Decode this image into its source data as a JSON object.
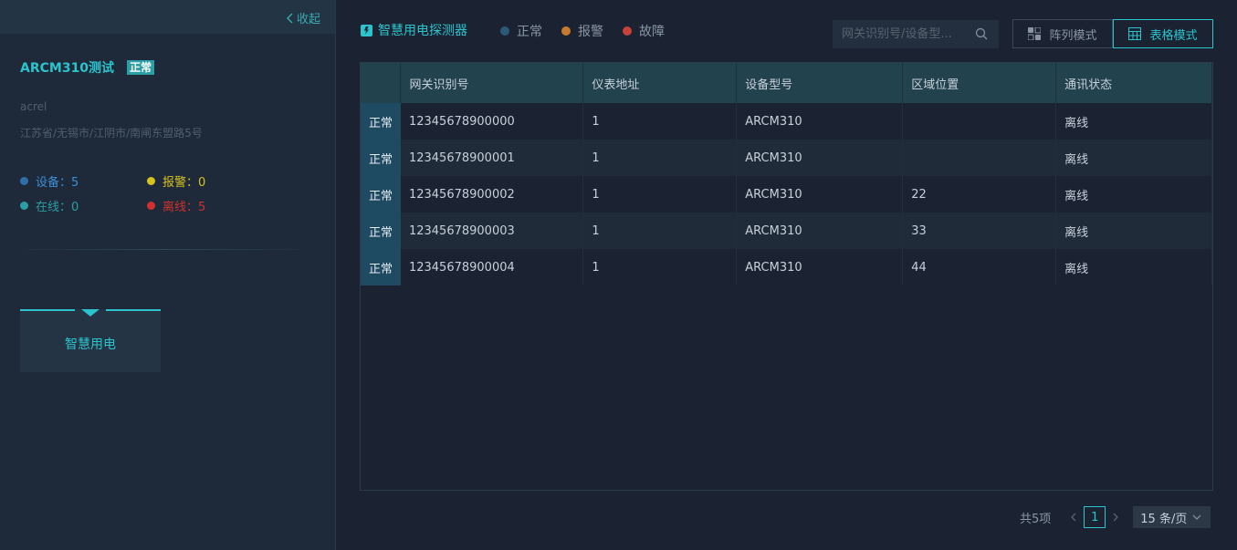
{
  "sidebar": {
    "collapse_label": "收起",
    "device_name": "ARCM310测试",
    "device_status": "正常",
    "company": "acrel",
    "address": "江苏省/无锡市/江阴市/南闸东盟路5号",
    "stats": {
      "devices": "设备：5",
      "alarm": "报警：0",
      "online": "在线：0",
      "offline": "离线：5"
    },
    "module_label": "智慧用电"
  },
  "header": {
    "title": "智慧用电探测器",
    "legend": [
      "正常",
      "报警",
      "故障"
    ],
    "search_placeholder": "网关识别号/设备型...",
    "list_mode": "阵列模式",
    "table_mode": "表格模式"
  },
  "table": {
    "columns": [
      "网关识别号",
      "仪表地址",
      "设备型号",
      "区域位置",
      "通讯状态"
    ],
    "rows": [
      {
        "status": "正常",
        "gateway": "12345678900000",
        "address": "1",
        "model": "ARCM310",
        "area": "",
        "comm": "离线"
      },
      {
        "status": "正常",
        "gateway": "12345678900001",
        "address": "1",
        "model": "ARCM310",
        "area": "",
        "comm": "离线"
      },
      {
        "status": "正常",
        "gateway": "12345678900002",
        "address": "1",
        "model": "ARCM310",
        "area": "22",
        "comm": "离线"
      },
      {
        "status": "正常",
        "gateway": "12345678900003",
        "address": "1",
        "model": "ARCM310",
        "area": "33",
        "comm": "离线"
      },
      {
        "status": "正常",
        "gateway": "12345678900004",
        "address": "1",
        "model": "ARCM310",
        "area": "44",
        "comm": "离线"
      }
    ]
  },
  "pager": {
    "total": "共5项",
    "current_page": "1",
    "page_size": "15 条/页"
  },
  "colors": {
    "accent": "#2bc3cc",
    "normal": "#2a5a78",
    "alarm": "#c77b2e",
    "fault": "#c8413a",
    "devices": "#2f6fa8",
    "alarm_stat": "#d6c21f",
    "online": "#2a9ea3",
    "offline": "#d1312c"
  }
}
